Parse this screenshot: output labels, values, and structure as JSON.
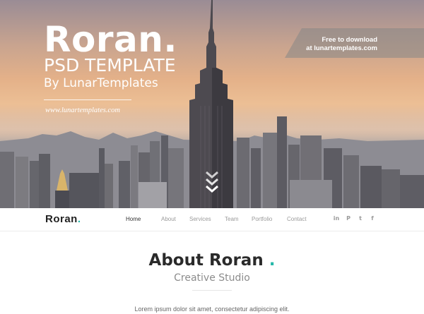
{
  "hero": {
    "title": "Roran.",
    "subtitle": "PSD TEMPLATE",
    "byline": "By LunarTemplates",
    "url": "www.lunartemplates.com",
    "ribbon": {
      "line1": "Free to download",
      "line2": "at lunartemplates.com"
    },
    "scroll_icon": "double-chevron-down-icon"
  },
  "navbar": {
    "logo_text": "Roran",
    "logo_dot": ".",
    "links": [
      {
        "label": "Home",
        "active": true
      },
      {
        "label": "About",
        "active": false
      },
      {
        "label": "Services",
        "active": false
      },
      {
        "label": "Team",
        "active": false
      },
      {
        "label": "Portfolio",
        "active": false
      },
      {
        "label": "Contact",
        "active": false
      }
    ],
    "socials": [
      {
        "icon": "linkedin-icon",
        "glyph": "in"
      },
      {
        "icon": "pinterest-icon",
        "glyph": "P"
      },
      {
        "icon": "twitter-icon",
        "glyph": "t"
      },
      {
        "icon": "facebook-icon",
        "glyph": "f"
      }
    ]
  },
  "about": {
    "title": "About Roran",
    "title_dot": ".",
    "subtitle": "Creative Studio",
    "text": "Lorem ipsum dolor sit amet, consectetur adipiscing elit."
  },
  "colors": {
    "accent": "#25b8a9",
    "text_dark": "#2a2a2a",
    "muted": "#9a9a9a"
  }
}
